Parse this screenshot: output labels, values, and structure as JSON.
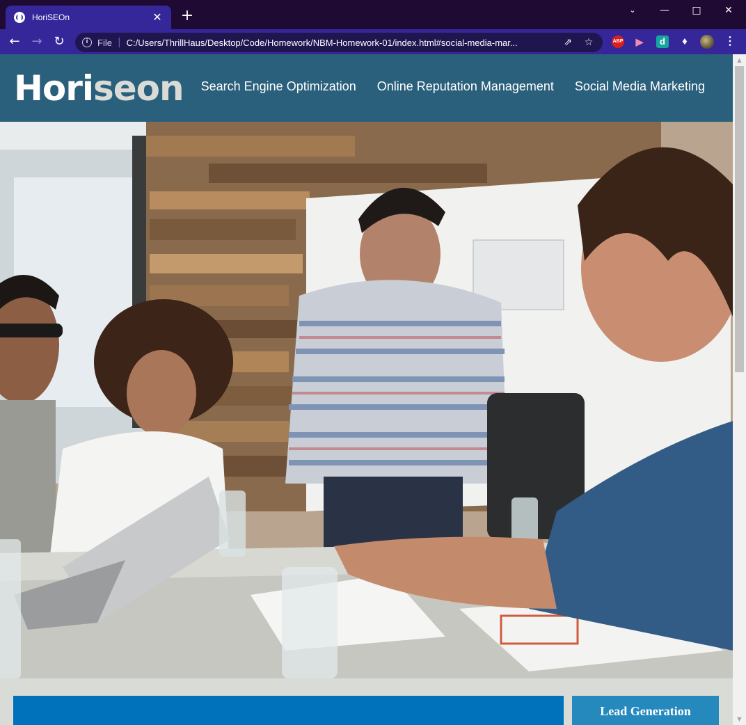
{
  "browser": {
    "tab_title": "HoriSEOn",
    "tab_close": "✕",
    "new_tab": "+",
    "scheme_label": "File",
    "url": "C:/Users/ThrillHaus/Desktop/Code/Homework/NBM-Homework-01/index.html#social-media-mar...",
    "icons": [
      "globe-icon",
      "back-arrow-icon",
      "forward-arrow-icon",
      "reload-icon",
      "info-icon",
      "share-icon",
      "star-icon",
      "adblock-icon",
      "extension-icon",
      "d-extension-icon",
      "puzzle-icon",
      "profile-avatar-icon",
      "kebab-menu-icon"
    ],
    "ext_abp": "ABP",
    "ext_d": "d"
  },
  "site": {
    "logo_main": "Hori",
    "logo_accent": "seon",
    "nav": [
      {
        "label": "Search Engine Optimization"
      },
      {
        "label": "Online Reputation Management"
      },
      {
        "label": "Social Media Marketing"
      }
    ]
  },
  "sidebar": {
    "first_benefit_title": "Lead Generation"
  },
  "colors": {
    "header_bg": "#2a607c",
    "page_bg": "#d9dcd6",
    "content_blue": "#0072bb",
    "benefit_blue": "#2589bd",
    "tab_purple": "#35279a"
  }
}
